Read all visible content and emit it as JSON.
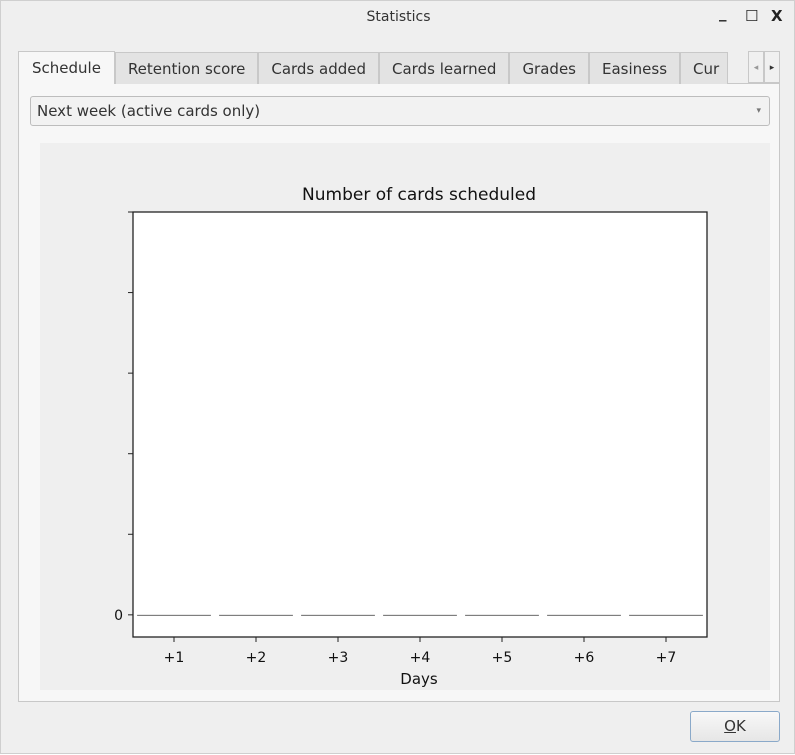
{
  "window": {
    "title": "Statistics",
    "minimize": "_",
    "maximize": "☐",
    "close": "X"
  },
  "tabs": [
    "Schedule",
    "Retention score",
    "Cards added",
    "Cards learned",
    "Grades",
    "Easiness",
    "Cur"
  ],
  "tab_scroll": {
    "left": "◂",
    "right": "▸"
  },
  "period_select": {
    "value": "Next week (active cards only)",
    "arrow": "▾"
  },
  "ok_button": {
    "underlined": "O",
    "rest": "K"
  },
  "chart_data": {
    "type": "bar",
    "title": "Number of cards scheduled",
    "xlabel": "Days",
    "ylabel": "",
    "categories": [
      "+1",
      "+2",
      "+3",
      "+4",
      "+5",
      "+6",
      "+7"
    ],
    "values": [
      0,
      0,
      0,
      0,
      0,
      0,
      0
    ],
    "xlim": [
      0.5,
      7.5
    ],
    "ylim": [
      -0.055,
      1
    ],
    "yticks": [
      0,
      0.2,
      0.4,
      0.6,
      0.8,
      1.0
    ],
    "ytick_labels": [
      "0",
      "",
      "",
      "",
      "",
      ""
    ],
    "grid": false
  }
}
